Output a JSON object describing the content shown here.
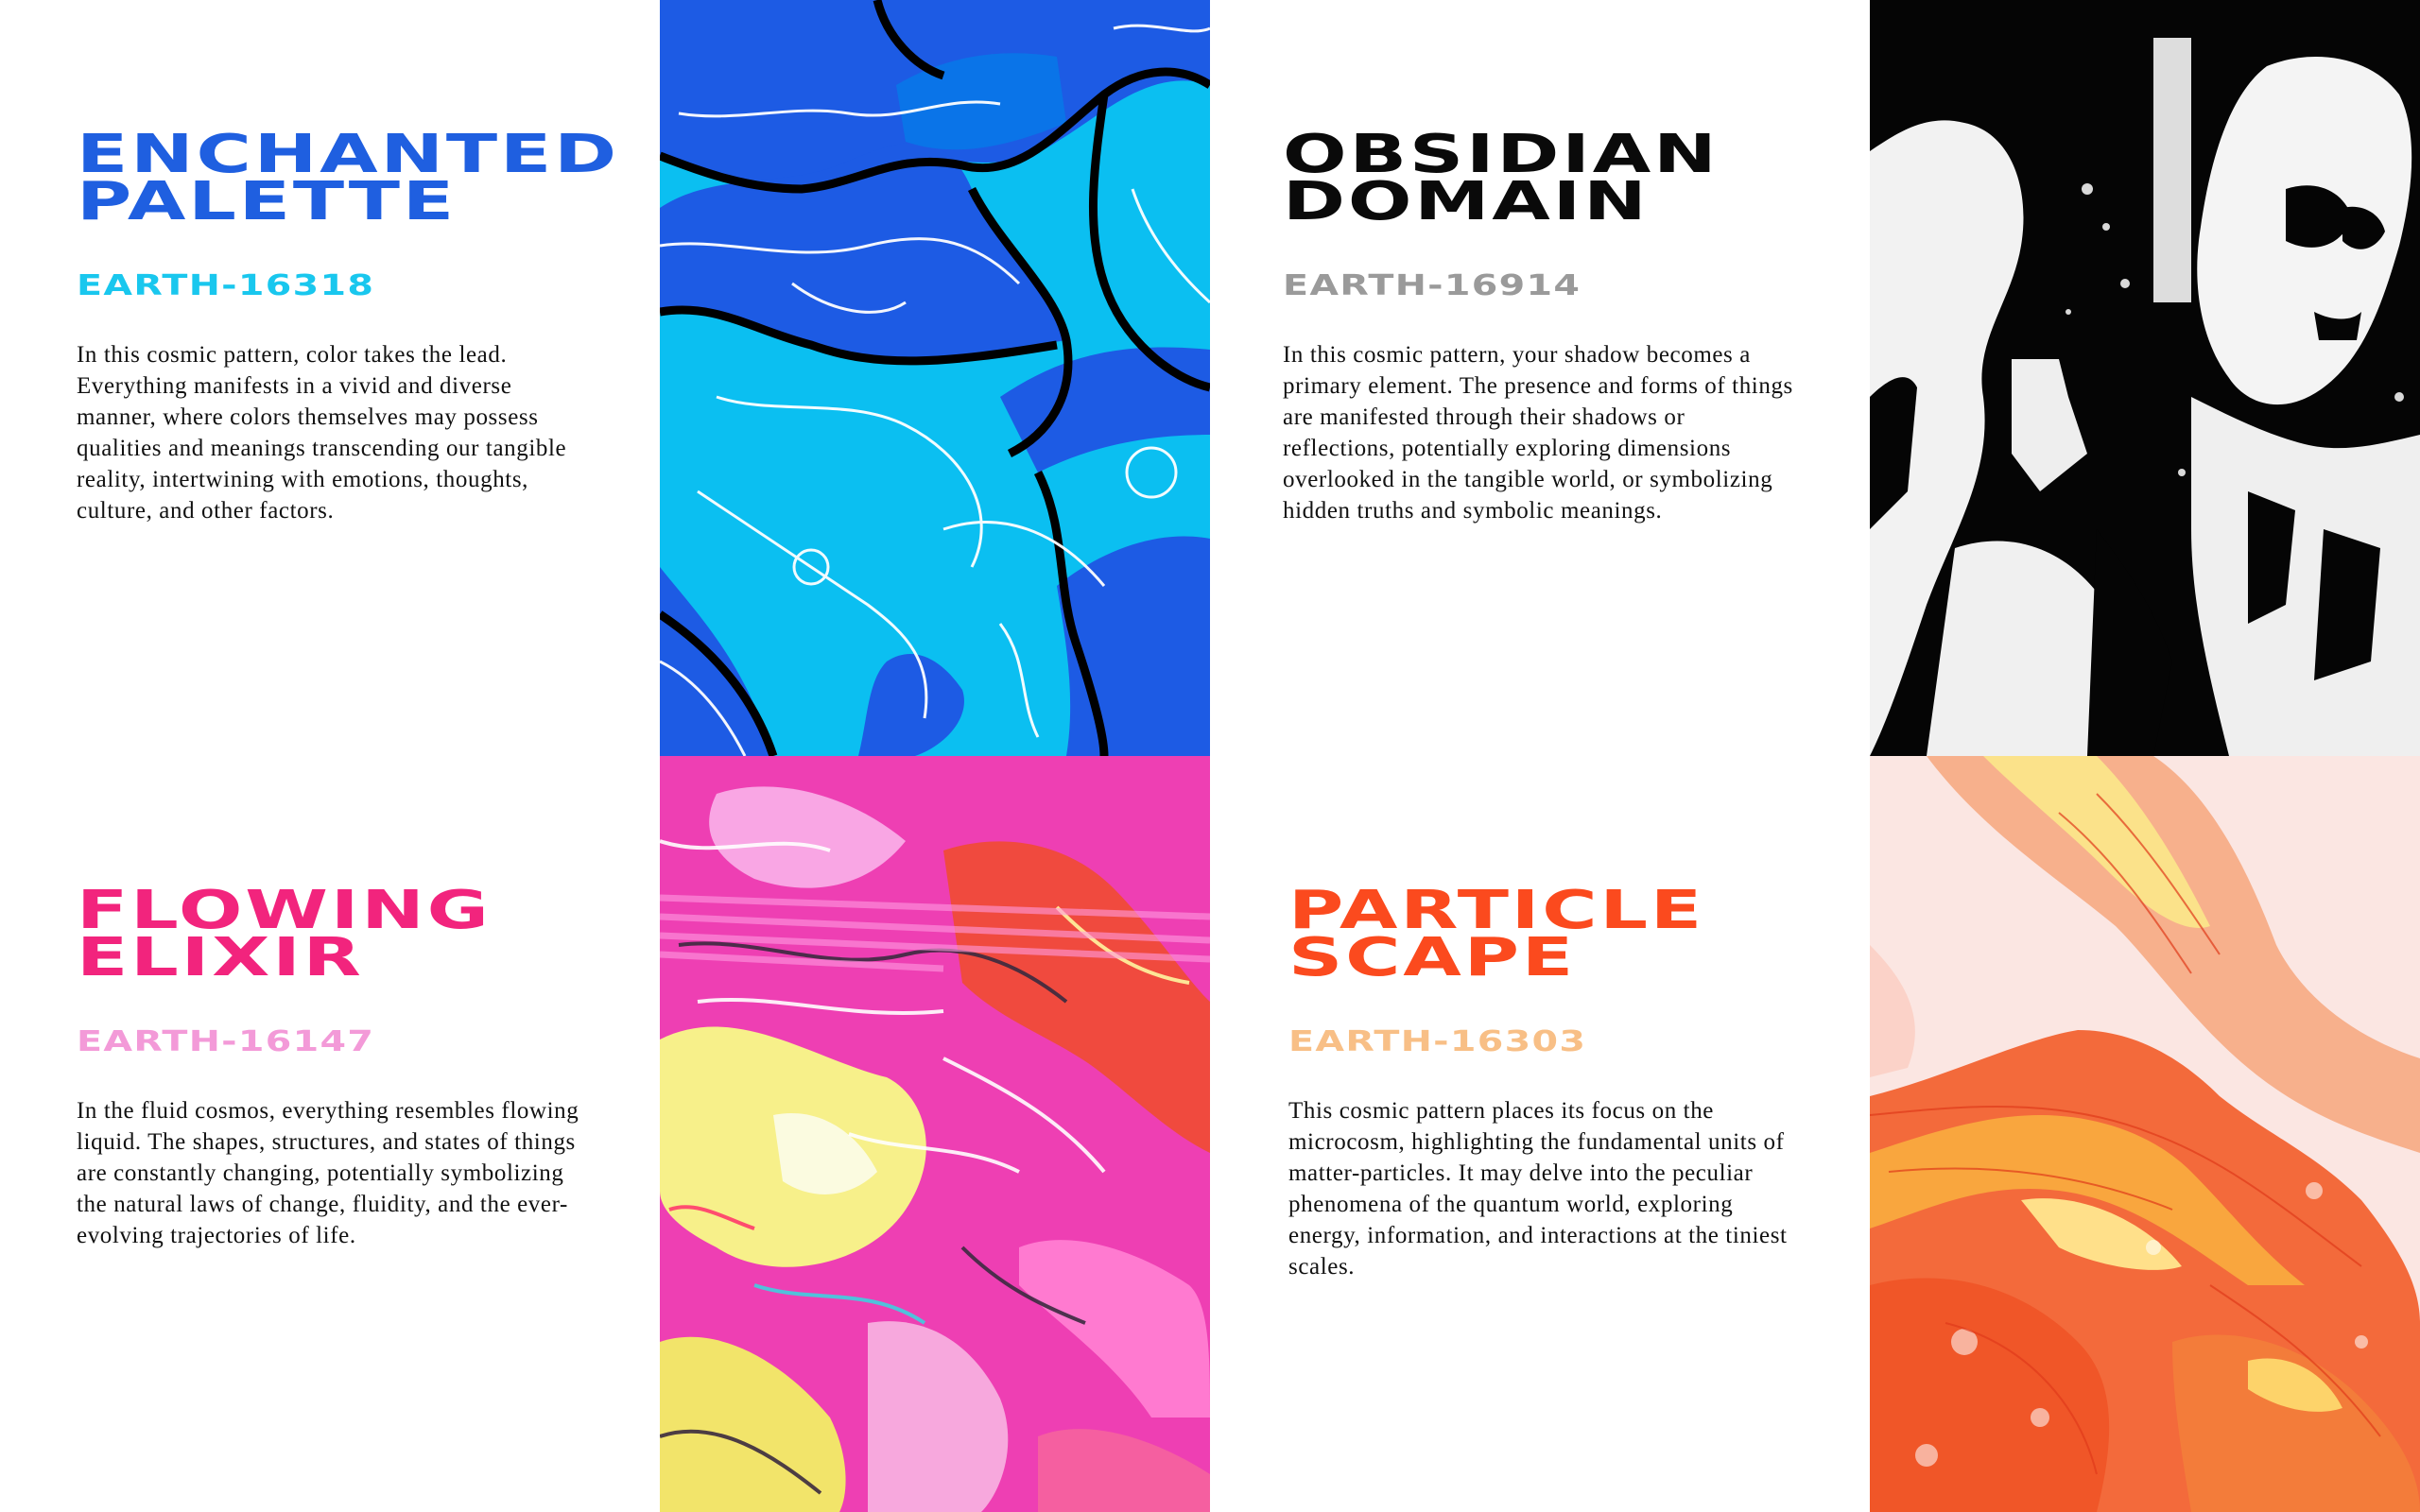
{
  "cards": [
    {
      "title_line1": "ENCHANTED",
      "title_line2": "PALETTE",
      "code": "EARTH-16318",
      "description": "In this cosmic pattern, color takes the lead. Everything manifests in a vivid and diverse manner, where colors themselves may possess qualities and meanings transcending our tangible reality, intertwining with emotions, thoughts, culture, and other factors.",
      "title_color": "#1f5fe0",
      "code_color": "#19c7ee"
    },
    {
      "title_line1": "OBSIDIAN",
      "title_line2": "DOMAIN",
      "code": "EARTH-16914",
      "description": "In this cosmic pattern, your shadow becomes a primary element. The presence and forms of things are manifested through their shadows or reflections, potentially exploring dimensions overlooked in the tangible world, or symbolizing hidden truths and symbolic meanings.",
      "title_color": "#0a0a0a",
      "code_color": "#9a9a9a"
    },
    {
      "title_line1": "FLOWING",
      "title_line2": "ELIXIR",
      "code": "EARTH-16147",
      "description": "In the fluid cosmos, everything resembles flowing liquid. The shapes, structures, and states of things are constantly changing, potentially symbolizing the natural laws of change, fluidity, and the ever-evolving trajectories of life.",
      "title_color": "#f2247d",
      "code_color": "#f39ad8"
    },
    {
      "title_line1": "PARTICLE",
      "title_line2": "SCAPE",
      "code": "EARTH-16303",
      "description": "This cosmic pattern places its focus on the microcosm, highlighting the fundamental units of matter-particles. It may delve into the peculiar phenomena of the quantum world, exploring energy, information, and interactions at the tiniest scales.",
      "title_color": "#fb4a1e",
      "code_color": "#f8bf86"
    }
  ]
}
